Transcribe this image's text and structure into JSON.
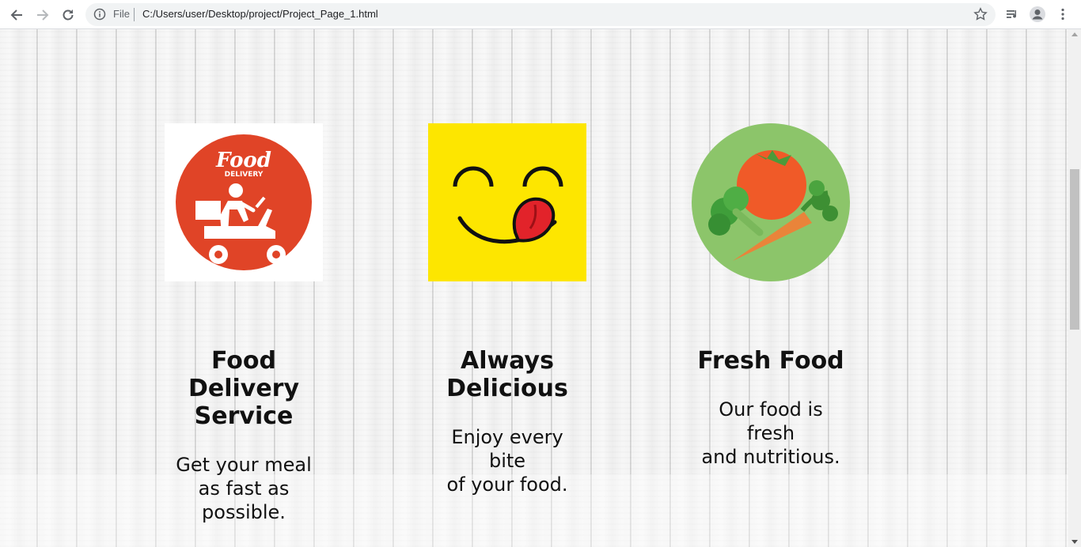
{
  "browser": {
    "back_icon": "arrow-left-icon",
    "forward_icon": "arrow-right-icon",
    "reload_icon": "reload-icon",
    "info_icon": "info-icon",
    "scheme_label": "File",
    "url": "C:/Users/user/Desktop/project/Project_Page_1.html",
    "star_icon": "star-icon",
    "media_icon": "media-queue-icon",
    "profile_icon": "profile-icon",
    "menu_icon": "kebab-menu-icon"
  },
  "features": [
    {
      "icon": "food-delivery-scooter-icon",
      "logo_text_1": "Food",
      "logo_text_2": "DELIVERY",
      "title": "Food\nDelivery\nService",
      "description": "Get your meal\nas fast as\npossible."
    },
    {
      "icon": "yummy-smiley-icon",
      "title": "Always\nDelicious",
      "description": "Enjoy every\nbite\nof your food."
    },
    {
      "icon": "fresh-vegetables-icon",
      "title": "Fresh Food",
      "description": "Our food is\nfresh\nand nutritious."
    }
  ],
  "colors": {
    "delivery_red": "#e04427",
    "smiley_yellow": "#fde600",
    "veg_green": "#8cc56a",
    "tomato": "#f05a28",
    "carrot": "#e9843a",
    "broccoli": "#3f9e3a"
  }
}
